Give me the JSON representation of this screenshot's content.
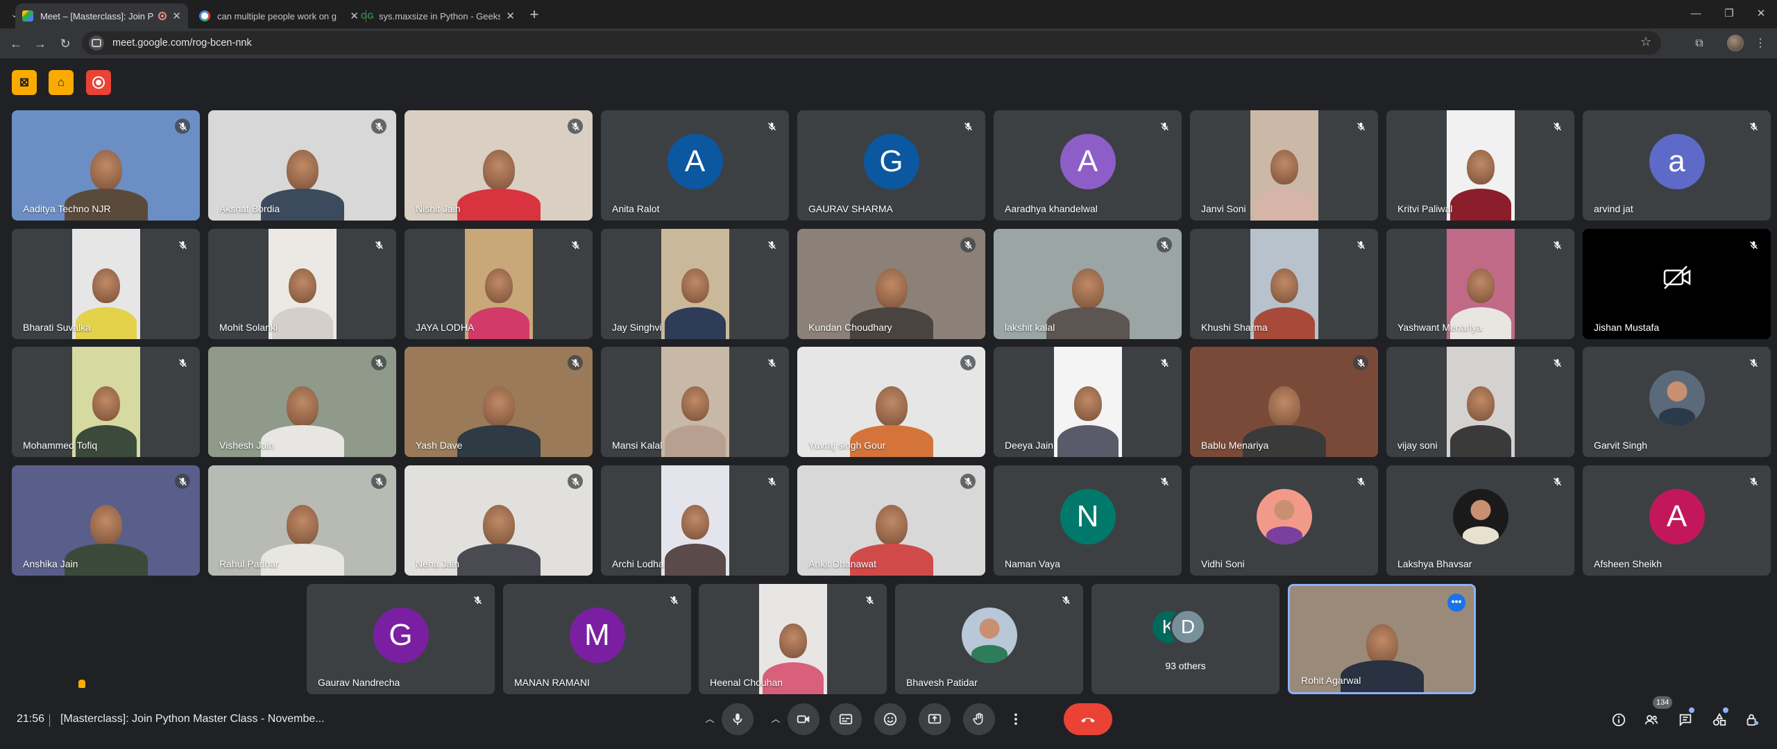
{
  "browser": {
    "tabs": [
      {
        "title": "Meet – [Masterclass]: Join P",
        "favicon_color": "#34a853"
      },
      {
        "title": "can multiple people work on g",
        "favicon_color": "#ffffff"
      },
      {
        "title": "sys.maxsize in Python - GeeksfG",
        "favicon_color": "#2f8d46"
      }
    ],
    "url": "meet.google.com/rog-bcen-nnk"
  },
  "grid_rows": [
    [
      {
        "name": "Aaditya Techno NJR",
        "kind": "video",
        "bg": "#6b8fc4",
        "body": "#5a4a3c",
        "fit": "full"
      },
      {
        "name": "Akshat Bordia",
        "kind": "video",
        "bg": "#d8d8d8",
        "body": "#3c4a5e",
        "fit": "full"
      },
      {
        "name": "Nishit Jain",
        "kind": "video",
        "bg": "#d9cfc2",
        "body": "#d93340",
        "fit": "full"
      },
      {
        "name": "Anita Ralot",
        "kind": "avatar",
        "letter": "A",
        "color": "#0b57a0"
      },
      {
        "name": "GAURAV SHARMA",
        "kind": "avatar",
        "letter": "G",
        "color": "#0b57a0"
      },
      {
        "name": "Aaradhya khandelwal",
        "kind": "avatar",
        "letter": "A",
        "color": "#8e5ec8"
      },
      {
        "name": "Janvi Soni",
        "kind": "video",
        "bg": "#cbb8a6",
        "body": "#d6b4a8",
        "fit": "narrow"
      },
      {
        "name": "Kritvi Paliwal",
        "kind": "video",
        "bg": "#f1f1f1",
        "body": "#8a1e2a",
        "fit": "narrow"
      },
      {
        "name": "arvind jat",
        "kind": "avatar",
        "letter": "a",
        "color": "#5e6ac8"
      }
    ],
    [
      {
        "name": "Bharati Suvalka",
        "kind": "video",
        "bg": "#e6e6e6",
        "body": "#e3d24a",
        "fit": "narrow"
      },
      {
        "name": "Mohit Solanki",
        "kind": "video",
        "bg": "#ece9e4",
        "body": "#d4cfca",
        "fit": "narrow"
      },
      {
        "name": "JAYA LODHA",
        "kind": "video",
        "bg": "#c8a878",
        "body": "#d23a6a",
        "fit": "narrow"
      },
      {
        "name": "Jay Singhvi",
        "kind": "video",
        "bg": "#c9b99a",
        "body": "#2e3c58",
        "fit": "narrow"
      },
      {
        "name": "Kundan Choudhary",
        "kind": "video",
        "bg": "#8b8178",
        "body": "#4a4440",
        "fit": "full"
      },
      {
        "name": "lakshit kalal",
        "kind": "video",
        "bg": "#9aa5a4",
        "body": "#5d5552",
        "fit": "full"
      },
      {
        "name": "Khushi Sharma",
        "kind": "video",
        "bg": "#b8c2cc",
        "body": "#a84a3a",
        "fit": "narrow"
      },
      {
        "name": "Yashwant Menariya",
        "kind": "video",
        "bg": "#c06a88",
        "body": "#e9e6e2",
        "fit": "narrow"
      },
      {
        "name": "Jishan Mustafa",
        "kind": "camoff"
      }
    ],
    [
      {
        "name": "Mohammed Tofiq",
        "kind": "video",
        "bg": "#d6d9a0",
        "body": "#3c4a3c",
        "fit": "narrow"
      },
      {
        "name": "Vishesh Jain",
        "kind": "video",
        "bg": "#8f9a8a",
        "body": "#e8e6e2",
        "fit": "full"
      },
      {
        "name": "Yash Dave",
        "kind": "video",
        "bg": "#9a7a58",
        "body": "#2e3a44",
        "fit": "full"
      },
      {
        "name": "Mansi Kalal",
        "kind": "video",
        "bg": "#c8b8a8",
        "body": "#b8a090",
        "fit": "narrow"
      },
      {
        "name": "Yuvraj singh Gour",
        "kind": "video",
        "bg": "#e6e6e6",
        "body": "#d4743a",
        "fit": "full"
      },
      {
        "name": "Deeya Jain",
        "kind": "video",
        "bg": "#f4f4f4",
        "body": "#5a5a6a",
        "fit": "narrow"
      },
      {
        "name": "Bablu Menariya",
        "kind": "video",
        "bg": "#7a4a38",
        "body": "#3a3a3a",
        "fit": "full"
      },
      {
        "name": "vijay soni",
        "kind": "video",
        "bg": "#d4d2d0",
        "body": "#3a3a3a",
        "fit": "narrow"
      },
      {
        "name": "Garvit Singh",
        "kind": "pic",
        "pic_bg": "#5a6a7a",
        "pic_body": "#2a3a4a"
      }
    ],
    [
      {
        "name": "Anshika Jain",
        "kind": "video",
        "bg": "#5a5e8a",
        "body": "#3a4a3a",
        "fit": "full"
      },
      {
        "name": "Rahul Parihar",
        "kind": "video",
        "bg": "#b8bab4",
        "body": "#e8e6e0",
        "fit": "full"
      },
      {
        "name": "Neha Jain",
        "kind": "video",
        "bg": "#e2e0dc",
        "body": "#4a4a52",
        "fit": "full"
      },
      {
        "name": "Archi Lodha",
        "kind": "video",
        "bg": "#e4e4ec",
        "body": "#5a4a4a",
        "fit": "narrow"
      },
      {
        "name": "Ankit Dhanawat",
        "kind": "video",
        "bg": "#d8d8d8",
        "body": "#d04a4a",
        "fit": "full"
      },
      {
        "name": "Naman Vaya",
        "kind": "avatar",
        "letter": "N",
        "color": "#00796b"
      },
      {
        "name": "Vidhi Soni",
        "kind": "pic",
        "pic_bg": "#f29a8a",
        "pic_body": "#7b3fa0"
      },
      {
        "name": "Lakshya Bhavsar",
        "kind": "pic",
        "pic_bg": "#1a1a1a",
        "pic_body": "#e8e0d0"
      },
      {
        "name": "Afsheen Sheikh",
        "kind": "avatar",
        "letter": "A",
        "color": "#c2185b"
      }
    ]
  ],
  "bottom_row": [
    {
      "name": "Gaurav Nandrecha",
      "kind": "avatar",
      "letter": "G",
      "color": "#7b1fa2"
    },
    {
      "name": "MANAN RAMANI",
      "kind": "avatar",
      "letter": "M",
      "color": "#7b1fa2"
    },
    {
      "name": "Heenal Chouhan",
      "kind": "video",
      "bg": "#e8e6e4",
      "body": "#d8607a",
      "fit": "narrow"
    },
    {
      "name": "Bhavesh Patidar",
      "kind": "pic",
      "pic_bg": "#b8c8d8",
      "pic_body": "#2e7d5a"
    },
    {
      "name": "93 others",
      "kind": "others",
      "letters": [
        "K",
        "D"
      ],
      "colors": [
        "#00695c",
        "#78909c"
      ]
    },
    {
      "name": "Rohit Agarwal",
      "kind": "self",
      "bg": "#9a8a7a",
      "body": "#2a3140"
    }
  ],
  "footer": {
    "time": "21:56",
    "meeting_title": "[Masterclass]: Join Python Master Class - Novembe...",
    "participants_count": "134"
  }
}
